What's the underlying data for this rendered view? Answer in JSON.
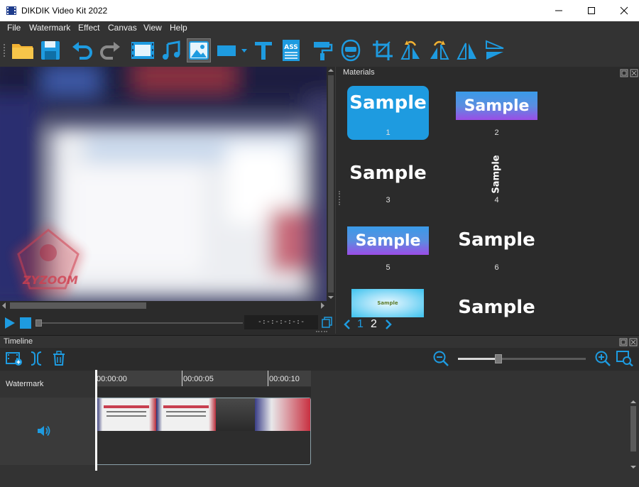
{
  "window": {
    "title": "DIKDIK Video Kit 2022",
    "controls": [
      "minimize",
      "maximize",
      "close"
    ]
  },
  "menu": [
    "File",
    "Watermark",
    "Effect",
    "Canvas",
    "View",
    "Help"
  ],
  "toolbar": {
    "icons": [
      "open-folder-icon",
      "save-icon",
      "undo-icon",
      "redo-icon",
      "video-icon",
      "music-icon",
      "image-icon",
      "rectangle-shape-icon",
      "text-icon",
      "ass-subtitle-icon",
      "paint-roller-icon",
      "mask-face-icon",
      "crop-icon",
      "rotate-left-icon",
      "rotate-right-icon",
      "flip-horizontal-icon",
      "flip-vertical-icon"
    ],
    "ass_label": "ASS"
  },
  "preview": {
    "watermark_logo_text": "ZYZOOM"
  },
  "player": {
    "time_display": "-:-:-:-:-:-"
  },
  "materials": {
    "title": "Materials",
    "items": [
      {
        "label": "Sample",
        "number": "1"
      },
      {
        "label": "Sample",
        "number": "2"
      },
      {
        "label": "Sample",
        "number": "3"
      },
      {
        "label": "Sample",
        "number": "4"
      },
      {
        "label": "Sample",
        "number": "5"
      },
      {
        "label": "Sample",
        "number": "6"
      },
      {
        "label": "Sample",
        "number": ""
      },
      {
        "label": "Sample",
        "number": ""
      }
    ],
    "pagination": {
      "pages": [
        "1",
        "2"
      ],
      "current": "2"
    }
  },
  "timeline": {
    "title": "Timeline",
    "ruler_ticks": [
      "00:00:00",
      "00:00:05",
      "00:00:10"
    ],
    "tracks": [
      {
        "name": "Watermark"
      },
      {
        "name": "",
        "icon": "speaker-icon"
      }
    ],
    "zoom_level": 0.5
  },
  "colors": {
    "accent": "#1e9be0",
    "panel_bg": "#2b2b2b",
    "toolbar_bg": "#333333"
  }
}
